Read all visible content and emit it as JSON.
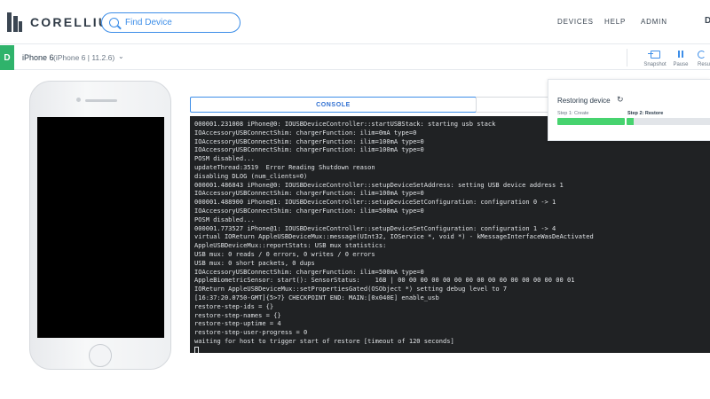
{
  "app": {
    "logo_text": "CORELLIUM"
  },
  "search": {
    "placeholder": "Find Device"
  },
  "nav": {
    "items": [
      "DEVICES",
      "HELP",
      "ADMIN"
    ],
    "avatar_partial": "D"
  },
  "device": {
    "badge": "D",
    "name": "iPhone 6",
    "meta": "(iPhone 6 | 11.2.6)",
    "dropdown_icon": "chevron-down-icon"
  },
  "toolbar": {
    "snapshot_label": "Snapshot",
    "pause_label": "Pause",
    "partial_label": "Resu"
  },
  "console": {
    "tab_label": "CONSOLE",
    "lines": [
      "000001.231008 iPhone@0: IOUSBDeviceController::startUSBStack: starting usb stack",
      "IOAccessoryUSBConnectShim: chargerFunction: ilim=0mA type=0",
      "IOAccessoryUSBConnectShim: chargerFunction: ilim=100mA type=0",
      "IOAccessoryUSBConnectShim: chargerFunction: ilim=100mA type=0",
      "POSM disabled...",
      "updateThread:3519  Error Reading Shutdown reason",
      "disabling DLOG (num_clients=0)",
      "000001.486843 iPhone@0: IOUSBDeviceController::setupDeviceSetAddress: setting USB device address 1",
      "IOAccessoryUSBConnectShim: chargerFunction: ilim=100mA type=0",
      "000001.488900 iPhone@1: IOUSBDeviceController::setupDeviceSetConfiguration: configuration 0 -> 1",
      "IOAccessoryUSBConnectShim: chargerFunction: ilim=500mA type=0",
      "POSM disabled...",
      "000001.773527 iPhone@1: IOUSBDeviceController::setupDeviceSetConfiguration: configuration 1 -> 4",
      "virtual IOReturn AppleUSBDeviceMux::message(UInt32, IOService *, void *) - kMessageInterfaceWasDeActivated",
      "AppleUSBDeviceMux::reportStats: USB mux statistics:",
      "USB mux: 0 reads / 0 errors, 0 writes / 0 errors",
      "USB mux: 0 short packets, 0 dups",
      "IOAccessoryUSBConnectShim: chargerFunction: ilim=500mA type=0",
      "AppleBiometricSensor: start(): SensorStatus:    16B | 00 00 00 00 00 00 00 00 00 00 00 00 00 00 00 01",
      "IOReturn AppleUSBDeviceMux::setPropertiesGated(OSObject *) setting debug level to 7",
      "[16:37:20.0750-GMT]{5>7} CHECKPOINT END: MAIN:[0x040E] enable_usb",
      "restore-step-ids = {}",
      "restore-step-names = {}",
      "restore-step-uptime = 4",
      "restore-step-user-progress = 0",
      "waiting for host to trigger start of restore [timeout of 120 seconds]"
    ]
  },
  "restore": {
    "title": "Restoring device",
    "step1": "Step 1: Create",
    "step2": "Step 2: Restore",
    "step1_progress": 1.0,
    "step2_progress": 0.08
  },
  "colors": {
    "accent": "#3d8ee8",
    "device_badge": "#2fb36b",
    "progress": "#47d36f",
    "console_bg": "#202224"
  }
}
